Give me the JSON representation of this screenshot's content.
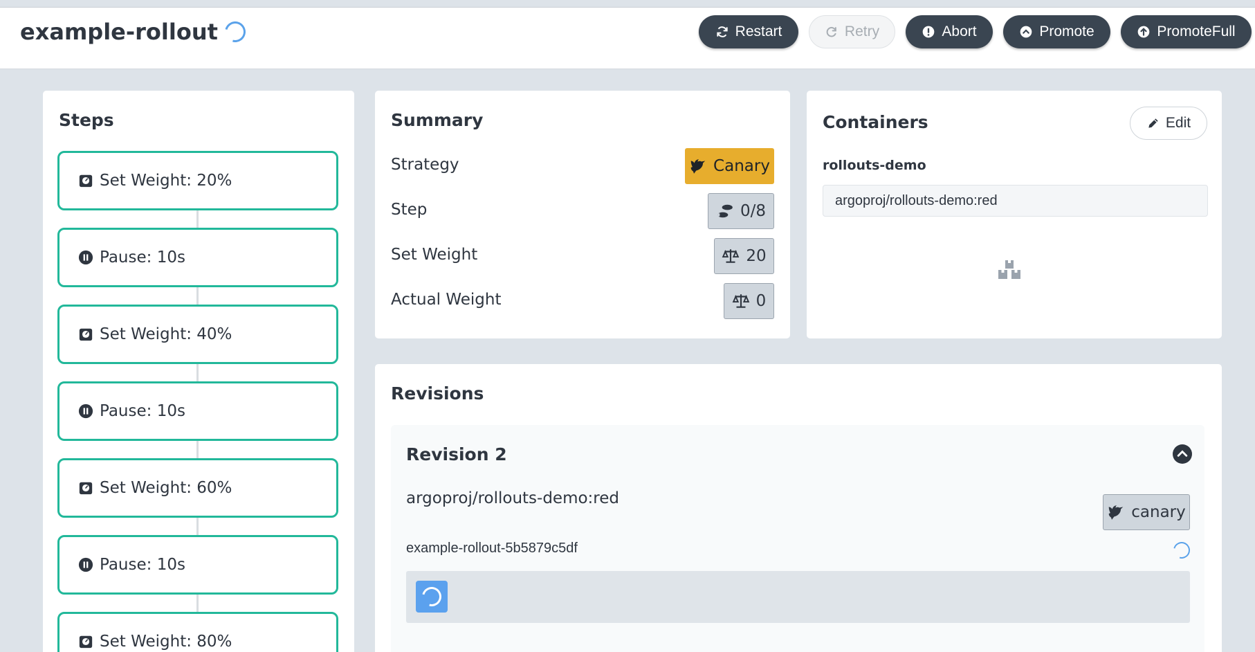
{
  "header": {
    "title": "example-rollout",
    "buttons": {
      "restart": "Restart",
      "retry": "Retry",
      "abort": "Abort",
      "promote": "Promote",
      "promote_full": "PromoteFull"
    }
  },
  "steps": {
    "title": "Steps",
    "items": [
      {
        "label": "Set Weight: 20%",
        "icon": "weight-icon"
      },
      {
        "label": "Pause: 10s",
        "icon": "pause-icon"
      },
      {
        "label": "Set Weight: 40%",
        "icon": "weight-icon"
      },
      {
        "label": "Pause: 10s",
        "icon": "pause-icon"
      },
      {
        "label": "Set Weight: 60%",
        "icon": "weight-icon"
      },
      {
        "label": "Pause: 10s",
        "icon": "pause-icon"
      },
      {
        "label": "Set Weight: 80%",
        "icon": "weight-icon"
      }
    ]
  },
  "summary": {
    "title": "Summary",
    "rows": [
      {
        "label": "Strategy",
        "value": "Canary"
      },
      {
        "label": "Step",
        "value": "0/8"
      },
      {
        "label": "Set Weight",
        "value": "20"
      },
      {
        "label": "Actual Weight",
        "value": "0"
      }
    ]
  },
  "containers": {
    "title": "Containers",
    "edit_label": "Edit",
    "name": "rollouts-demo",
    "image": "argoproj/rollouts-demo:red"
  },
  "revisions": {
    "title": "Revisions",
    "items": [
      {
        "title": "Revision 2",
        "image": "argoproj/rollouts-demo:red",
        "badge": "canary",
        "replicaset": "example-rollout-5b5879c5df"
      }
    ]
  },
  "colors": {
    "accent_step_border": "#22b89a",
    "canary_gold": "#e7ad2d",
    "spinner_blue": "#5aa2ea",
    "dark_button": "#3a4551"
  }
}
